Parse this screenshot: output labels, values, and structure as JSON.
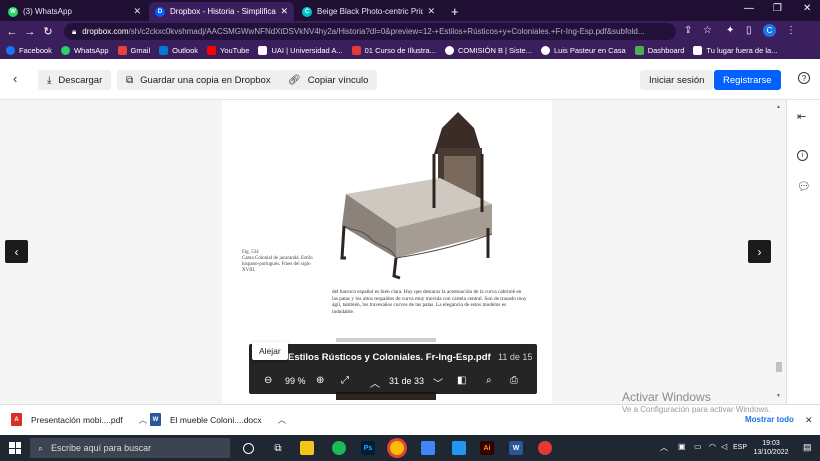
{
  "browser": {
    "tabs": [
      {
        "title": "(3) WhatsApp",
        "color": "#25d366",
        "glyph": "W",
        "active": false
      },
      {
        "title": "Dropbox - Historia - Simplifica tu",
        "color": "#0061fe",
        "glyph": "D",
        "active": true
      },
      {
        "title": "Beige Black Photo-centric Pride S",
        "color": "#00c4cc",
        "glyph": "C",
        "active": false
      }
    ],
    "url_host": "dropbox.com",
    "url_path": "/sh/c2ckxc0kvshmadj/AACSMGWwNFNdXtDSVkNV4hy2a/Historia?dl=0&preview=12-+Estilos+Rústicos+y+Coloniales.+Fr-Ing-Esp.pdf&subfold...",
    "profile_initial": "C",
    "bookmarks": [
      {
        "label": "Facebook",
        "color": "#1877f2"
      },
      {
        "label": "WhatsApp",
        "color": "#25d366"
      },
      {
        "label": "Gmail",
        "color": "#ea4335"
      },
      {
        "label": "Outlook",
        "color": "#0078d4"
      },
      {
        "label": "YouTube",
        "color": "#ff0000"
      },
      {
        "label": "UAI | Universidad A...",
        "color": "#ffffff"
      },
      {
        "label": "01 Curso de Illustra...",
        "color": "#e53935"
      },
      {
        "label": "COMISIÓN B | Siste...",
        "color": "#ffffff"
      },
      {
        "label": "Luis Pasteur en Casa",
        "color": "#ffffff"
      },
      {
        "label": "Dashboard",
        "color": "#4caf50"
      },
      {
        "label": "Tu lugar fuera de la...",
        "color": "#ffffff"
      }
    ]
  },
  "dropbox": {
    "download_label": "Descargar",
    "save_copy_label": "Guardar una copia en Dropbox",
    "copy_link_label": "Copiar vínculo",
    "login_label": "Iniciar sesión",
    "signup_label": "Registrarse",
    "accent": "#0061fe"
  },
  "document": {
    "caption": "Fig. 534\nCama Colonial de jacarandá. Estilo hispano-portugués. Fines del siglo XVIII.",
    "body": "del barroco español es bien clara. Hay que destacar la acentuación de la curva cabriolé en las patas y los altos respaldos de curva muy movida con cartela central. Son de trazado muy ágil, también, los travesaños curvos de las patas. La elegancia de estos modelos es indudable."
  },
  "pdf_toolbar": {
    "tooltip": "Alejar",
    "filename": "Estilos Rústicos y Coloniales. Fr-Ing-Esp.pdf",
    "file_position": "11 de 15",
    "zoom": "99 %",
    "page_indicator": "31 de 33"
  },
  "downloads": [
    {
      "name": "Presentación mobi....pdf",
      "color": "#d93025",
      "glyph": "A"
    },
    {
      "name": "El mueble Coloni....docx",
      "color": "#2b579a",
      "glyph": "W"
    }
  ],
  "downloads_show_all": "Mostrar todo",
  "watermark": {
    "title": "Activar Windows",
    "subtitle": "Ve a Configuración para activar Windows."
  },
  "taskbar": {
    "search_placeholder": "Escribe aquí para buscar",
    "language": "ESP",
    "time": "19:03",
    "date": "13/10/2022"
  }
}
